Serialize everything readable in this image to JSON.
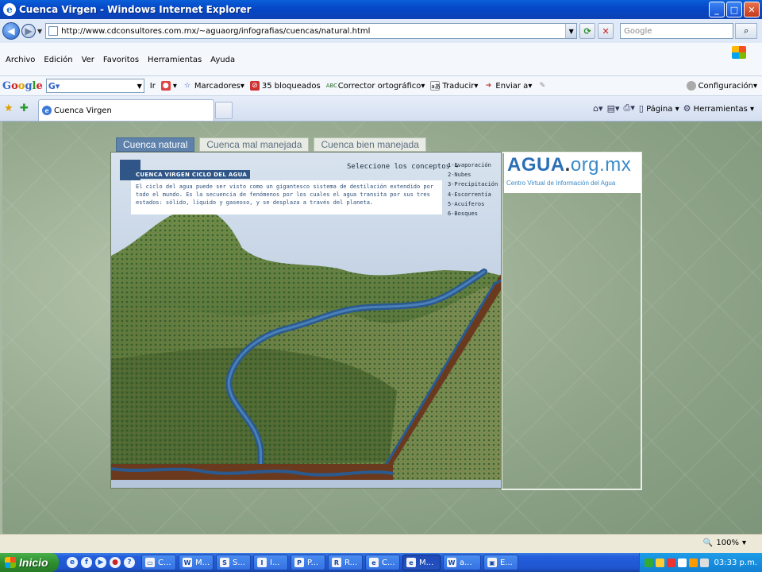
{
  "window": {
    "title": "Cuenca Virgen - Windows Internet Explorer",
    "minimize": "_",
    "maximize": "□",
    "close": "✕"
  },
  "address": {
    "url": "http://www.cdconsultores.com.mx/~aguaorg/infografias/cuencas/natural.html",
    "search_placeholder": "Google"
  },
  "menu": {
    "items": [
      "Archivo",
      "Edición",
      "Ver",
      "Favoritos",
      "Herramientas",
      "Ayuda"
    ]
  },
  "google_toolbar": {
    "go_label": "Ir",
    "bookmarks_label": "Marcadores",
    "blocked_label": "35 bloqueados",
    "spellcheck_label": "Corrector ortográfico",
    "translate_label": "Traducir",
    "send_label": "Enviar a",
    "settings_label": "Configuración"
  },
  "tabs": {
    "active_tab": "Cuenca Virgen"
  },
  "command_bar": {
    "page_label": "Página",
    "tools_label": "Herramientas"
  },
  "page": {
    "section_tabs": [
      "Cuenca natural",
      "Cuenca mal manejada",
      "Cuenca bien manejada"
    ],
    "panel_title": "CUENCA VIRGEN CICLO DEL AGUA",
    "description": "El ciclo del agua puede ser visto como un gigantesco sistema de destilación extendido por todo el mundo. Es la secuencia de fenómenos por los cuales el agua transita por sus tres estados: sólido, líquido y gaseoso, y se desplaza a través del planeta.",
    "concepts_label": "Seleccione los conceptos",
    "concepts": [
      "1-Evaporación",
      "2-Nubes",
      "3-Precipitación",
      "4-Escorrentía",
      "5-Acuíferos",
      "6-Bosques"
    ],
    "logo_agua": "AGUA",
    "logo_dot": ".",
    "logo_tld": "org.mx",
    "logo_subtitle": "Centro Virtual de Información del Agua"
  },
  "status": {
    "zoom": "100%"
  },
  "taskbar": {
    "start_label": "Inicio",
    "tasks": [
      "C...",
      "M...",
      "S...",
      "I...",
      "P...",
      "R...",
      "C...",
      "M...",
      "a...",
      "E..."
    ],
    "clock": "03:33 p.m."
  },
  "colors": {
    "active_tab": "#5e82ab",
    "river": "#2a5a8f",
    "logo_blue": "#2b6fb5"
  }
}
